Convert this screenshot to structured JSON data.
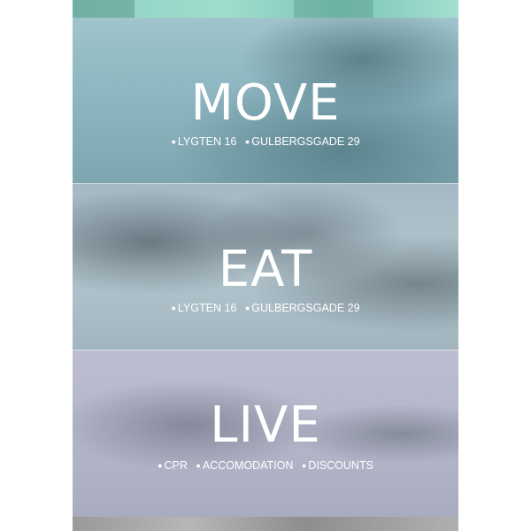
{
  "sections": [
    {
      "heading": "MOVE",
      "links": [
        {
          "bullet": "●",
          "label": "LYGTEN 16"
        },
        {
          "bullet": "●",
          "label": "GULBERGSGADE 29"
        }
      ]
    },
    {
      "heading": "EAT",
      "links": [
        {
          "bullet": "●",
          "label": "LYGTEN 16"
        },
        {
          "bullet": "●",
          "label": "GULBERGSGADE 29"
        }
      ]
    },
    {
      "heading": "LIVE",
      "links": [
        {
          "bullet": "●",
          "label": "CPR"
        },
        {
          "bullet": "●",
          "label": "ACCOMODATION"
        },
        {
          "bullet": "●",
          "label": "DISCOUNTS"
        }
      ]
    }
  ],
  "colors": {
    "move_overlay": "#8fb8c2",
    "eat_overlay": "#a4b9c4",
    "live_overlay": "#b3b5c9",
    "text": "#ffffff"
  }
}
